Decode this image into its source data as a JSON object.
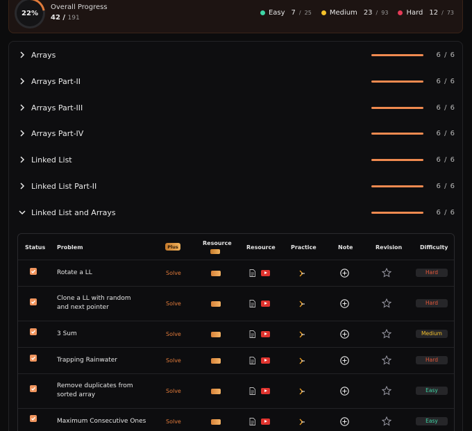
{
  "overall": {
    "percent": "22%",
    "percent_value": 22,
    "title": "Overall Progress",
    "done": "42",
    "sep": " / ",
    "total": "191"
  },
  "legend": [
    {
      "label": "Easy",
      "done": "7",
      "total": "25",
      "color": "#3ed6a6"
    },
    {
      "label": "Medium",
      "done": "23",
      "total": "93",
      "color": "#f4c12a"
    },
    {
      "label": "Hard",
      "done": "12",
      "total": "73",
      "color": "#e53b57"
    }
  ],
  "topics": [
    {
      "name": "Arrays",
      "count": "6 / 6",
      "progress": 1.0,
      "expanded": false
    },
    {
      "name": "Arrays Part-II",
      "count": "6 / 6",
      "progress": 1.0,
      "expanded": false
    },
    {
      "name": "Arrays Part-III",
      "count": "6 / 6",
      "progress": 1.0,
      "expanded": false
    },
    {
      "name": "Arrays Part-IV",
      "count": "6 / 6",
      "progress": 1.0,
      "expanded": false
    },
    {
      "name": "Linked List",
      "count": "6 / 6",
      "progress": 1.0,
      "expanded": false
    },
    {
      "name": "Linked List Part-II",
      "count": "6 / 6",
      "progress": 1.0,
      "expanded": false
    },
    {
      "name": "Linked List and Arrays",
      "count": "6 / 6",
      "progress": 1.0,
      "expanded": true
    }
  ],
  "table": {
    "headers": {
      "status": "Status",
      "problem": "Problem",
      "plus": "Plus",
      "resource_plus": "Resource",
      "resource": "Resource",
      "practice": "Practice",
      "note": "Note",
      "revision": "Revision",
      "difficulty": "Difficulty"
    },
    "solve_label": "Solve",
    "rows": [
      {
        "problem": "Rotate a LL",
        "difficulty": "Hard",
        "checked": true
      },
      {
        "problem": "Clone a LL with random and next pointer",
        "difficulty": "Hard",
        "checked": true
      },
      {
        "problem": "3 Sum",
        "difficulty": "Medium",
        "checked": true
      },
      {
        "problem": "Trapping Rainwater",
        "difficulty": "Hard",
        "checked": true
      },
      {
        "problem": "Remove duplicates from sorted array",
        "difficulty": "Easy",
        "checked": true
      },
      {
        "problem": "Maximum Consecutive Ones",
        "difficulty": "Easy",
        "checked": true
      }
    ]
  },
  "difficulty_colors": {
    "Easy": "#3ed6a6",
    "Medium": "#f4c12a",
    "Hard": "#e8583a"
  }
}
